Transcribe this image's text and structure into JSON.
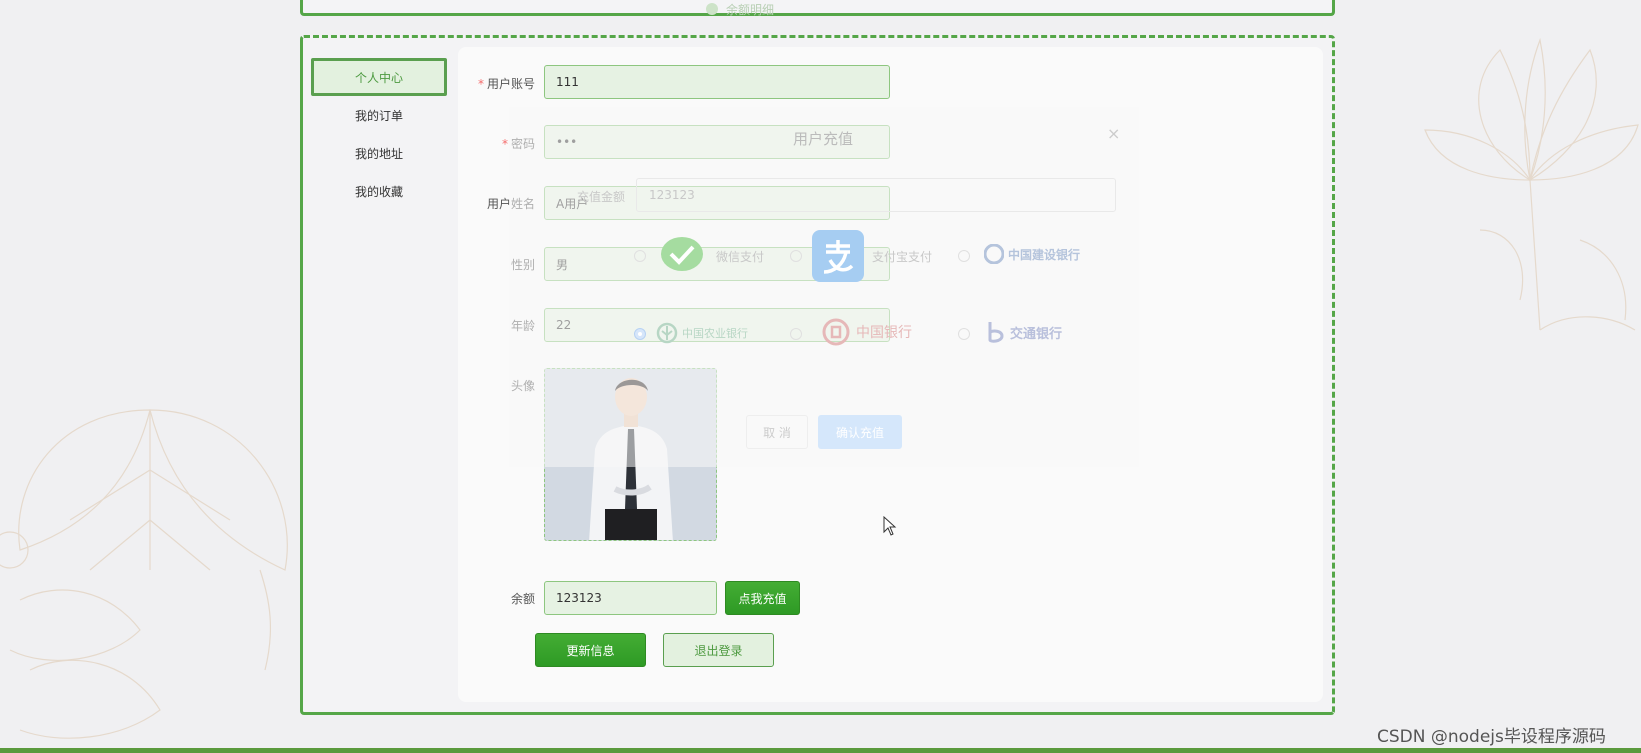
{
  "top_bar": {
    "faded_text": "余额明细"
  },
  "sidebar": {
    "items": [
      {
        "label": "个人中心",
        "active": true
      },
      {
        "label": "我的订单",
        "active": false
      },
      {
        "label": "我的地址",
        "active": false
      },
      {
        "label": "我的收藏",
        "active": false
      }
    ]
  },
  "form": {
    "account": {
      "label": "用户账号",
      "value": "111",
      "required": true
    },
    "password": {
      "label": "密码",
      "value": "•••",
      "required": true
    },
    "name": {
      "label": "用户姓名",
      "value": "A用户"
    },
    "gender": {
      "label": "性别",
      "value": "男"
    },
    "age": {
      "label": "年龄",
      "value": "22"
    },
    "avatar": {
      "label": "头像"
    },
    "balance": {
      "label": "余额",
      "value": "123123"
    },
    "recharge_button": "点我充值",
    "update_button": "更新信息",
    "logout_button": "退出登录"
  },
  "dialog": {
    "title": "用户充值",
    "close": "×",
    "amount_label": "充值金额",
    "amount_value": "123123",
    "options": [
      {
        "label": "微信支付",
        "checked": false
      },
      {
        "label": "支付宝支付",
        "checked": false
      },
      {
        "label": "中国建设银行",
        "checked": false
      },
      {
        "label": "中国农业银行",
        "checked": true
      },
      {
        "label": "中国银行",
        "checked": false
      },
      {
        "label": "交通银行",
        "checked": false
      }
    ],
    "cancel": "取 消",
    "confirm": "确认充值"
  },
  "watermark": "CSDN @nodejs毕设程序源码",
  "colors": {
    "accent": "#55a648",
    "button": "#2e9a25",
    "confirm_faded": "#d5e7fb"
  }
}
